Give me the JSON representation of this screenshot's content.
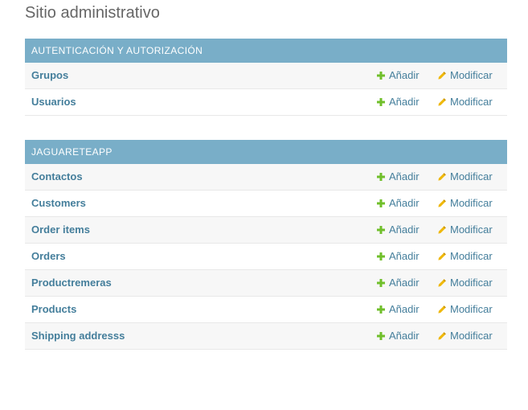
{
  "page_title": "Sitio administrativo",
  "colors": {
    "caption_bg": "#79aec8",
    "link": "#447e9b",
    "add_icon": "#70bf2b",
    "change_icon": "#efb80b"
  },
  "modules": [
    {
      "caption": "AUTENTICACIÓN Y AUTORIZACIÓN",
      "rows": [
        {
          "name": "Grupos",
          "add_label": "Añadir",
          "change_label": "Modificar"
        },
        {
          "name": "Usuarios",
          "add_label": "Añadir",
          "change_label": "Modificar"
        }
      ]
    },
    {
      "caption": "JAGUARETEAPP",
      "rows": [
        {
          "name": "Contactos",
          "add_label": "Añadir",
          "change_label": "Modificar"
        },
        {
          "name": "Customers",
          "add_label": "Añadir",
          "change_label": "Modificar"
        },
        {
          "name": "Order items",
          "add_label": "Añadir",
          "change_label": "Modificar"
        },
        {
          "name": "Orders",
          "add_label": "Añadir",
          "change_label": "Modificar"
        },
        {
          "name": "Productremeras",
          "add_label": "Añadir",
          "change_label": "Modificar"
        },
        {
          "name": "Products",
          "add_label": "Añadir",
          "change_label": "Modificar"
        },
        {
          "name": "Shipping addresss",
          "add_label": "Añadir",
          "change_label": "Modificar"
        }
      ]
    }
  ]
}
